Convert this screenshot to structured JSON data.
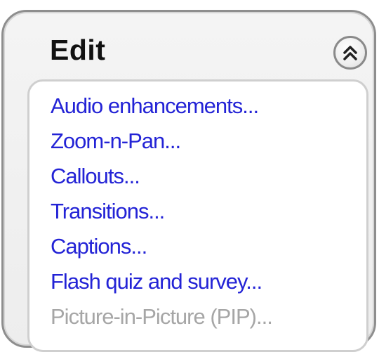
{
  "panel": {
    "title": "Edit",
    "collapse_icon": "double-chevron-up-icon",
    "items": [
      {
        "label": "Audio enhancements...",
        "enabled": true
      },
      {
        "label": "Zoom-n-Pan...",
        "enabled": true
      },
      {
        "label": "Callouts...",
        "enabled": true
      },
      {
        "label": "Transitions...",
        "enabled": true
      },
      {
        "label": "Captions...",
        "enabled": true
      },
      {
        "label": "Flash quiz and survey...",
        "enabled": true
      },
      {
        "label": "Picture-in-Picture (PIP)...",
        "enabled": false
      }
    ]
  },
  "colors": {
    "link": "#2323d6",
    "disabled": "#a6a6a6",
    "title": "#111111"
  }
}
